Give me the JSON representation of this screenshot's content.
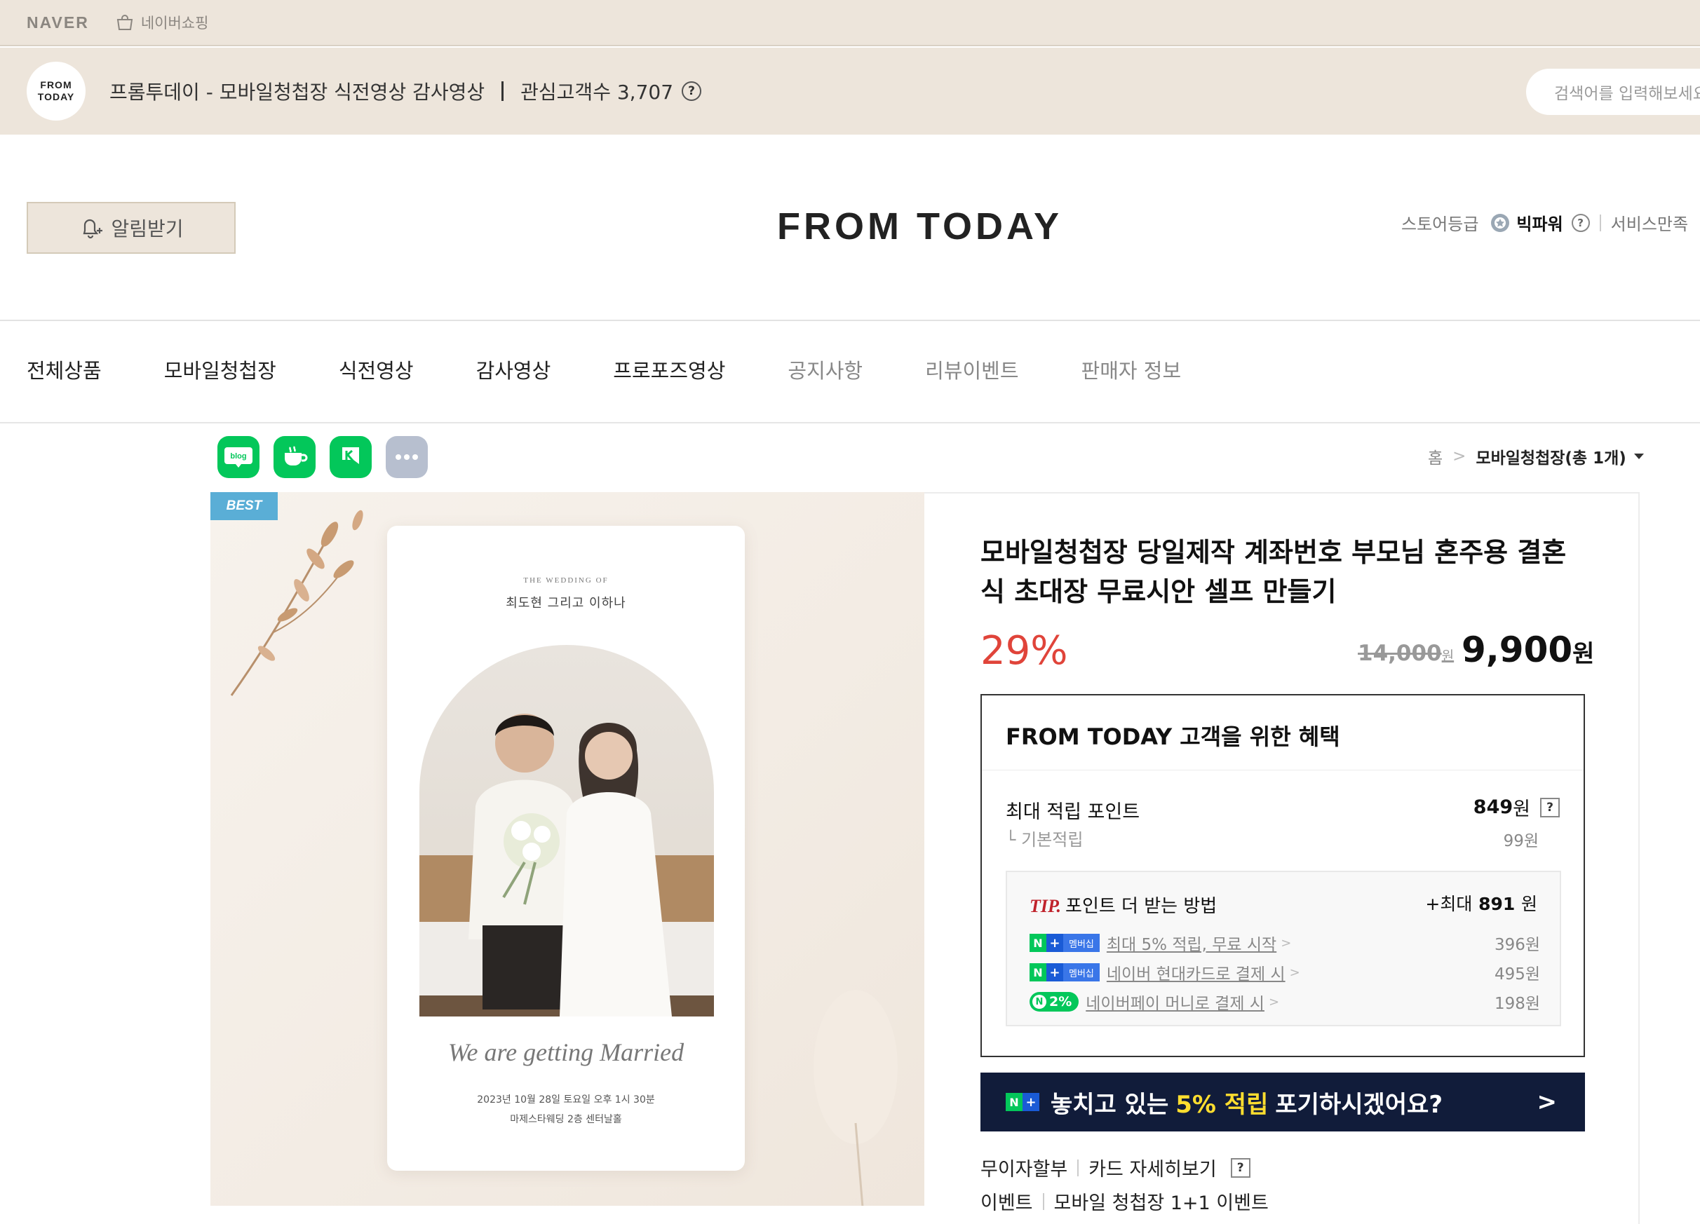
{
  "topbar": {
    "naver_logo": "NAVER",
    "shopping_label": "네이버쇼핑"
  },
  "store": {
    "logo_line1": "FROM",
    "logo_line2": "TODAY",
    "name": "프롬투데이 - 모바일청첩장 식전영상 감사영상",
    "fans": "관심고객수 3,707",
    "help_q": "?",
    "search_placeholder": "검색어를 입력해보세요"
  },
  "header": {
    "alarm_label": "알림받기",
    "brand": "FROM TODAY",
    "grade_label": "스토어등급",
    "grade_value": "빅파워",
    "grade_help": "?",
    "service": "서비스만족"
  },
  "nav": {
    "items": [
      "전체상품",
      "모바일청첩장",
      "식전영상",
      "감사영상",
      "프로포즈영상",
      "공지사항",
      "리뷰이벤트",
      "판매자 정보"
    ]
  },
  "share": {
    "blog": "blog"
  },
  "breadcrumb": {
    "home": "홈",
    "sep": ">",
    "current": "모바일청첩장(총 1개)"
  },
  "product": {
    "badge": "BEST",
    "card": {
      "subtitle": "THE WEDDING OF",
      "names": "최도현  그리고  이하나",
      "script": "We are getting Married",
      "date": "2023년 10월 28일 토요일 오후 1시 30분",
      "venue": "마제스타웨딩 2층 센터날홀"
    },
    "title": "모바일청첩장 당일제작 계좌번호 부모님 혼주용 결혼식 초대장 무료시안 셀프 만들기",
    "discount": "29%",
    "original_price": "14,000",
    "original_unit": "원",
    "price": "9,900",
    "price_unit": "원"
  },
  "benefit": {
    "title": "FROM TODAY 고객을 위한 혜택",
    "max_points_label": "최대 적립 포인트",
    "max_points_value": "849",
    "max_points_unit": "원",
    "help_q": "?",
    "base_label": "└ 기본적립",
    "base_value": "99원",
    "tip_mark": "TIP.",
    "tip_text": "포인트 더 받는 방법",
    "tip_max_prefix": "+최대",
    "tip_max_value": "891",
    "tip_max_unit": "원",
    "rows": [
      {
        "badge_n": "N",
        "badge_plus": "+",
        "badge_mem": "멤버십",
        "text": "최대 5% 적립, 무료 시작",
        "chev": ">",
        "amount": "396원"
      },
      {
        "badge_n": "N",
        "badge_plus": "+",
        "badge_mem": "멤버십",
        "text": "네이버 현대카드로 결제 시",
        "chev": ">",
        "amount": "495원"
      },
      {
        "badge_n": "N",
        "badge_pct": "2%",
        "text": "네이버페이 머니로 결제 시",
        "chev": ">",
        "amount": "198원"
      }
    ]
  },
  "banner": {
    "badge_n": "N",
    "badge_plus": "+",
    "pre": "놓치고 있는",
    "highlight": "5% 적립",
    "post": "포기하시겠어요?",
    "arrow": ">"
  },
  "extras": [
    {
      "label": "무이자할부",
      "value": "카드 자세히보기",
      "help": "?"
    },
    {
      "label": "이벤트",
      "value": "모바일 청첩장 1+1 이벤트"
    }
  ],
  "colors": {
    "accent_bg": "#ede5db",
    "discount": "#e0443a",
    "naver_green": "#03c75a",
    "banner_bg": "#111c3a",
    "banner_highlight": "#ffde2f"
  }
}
